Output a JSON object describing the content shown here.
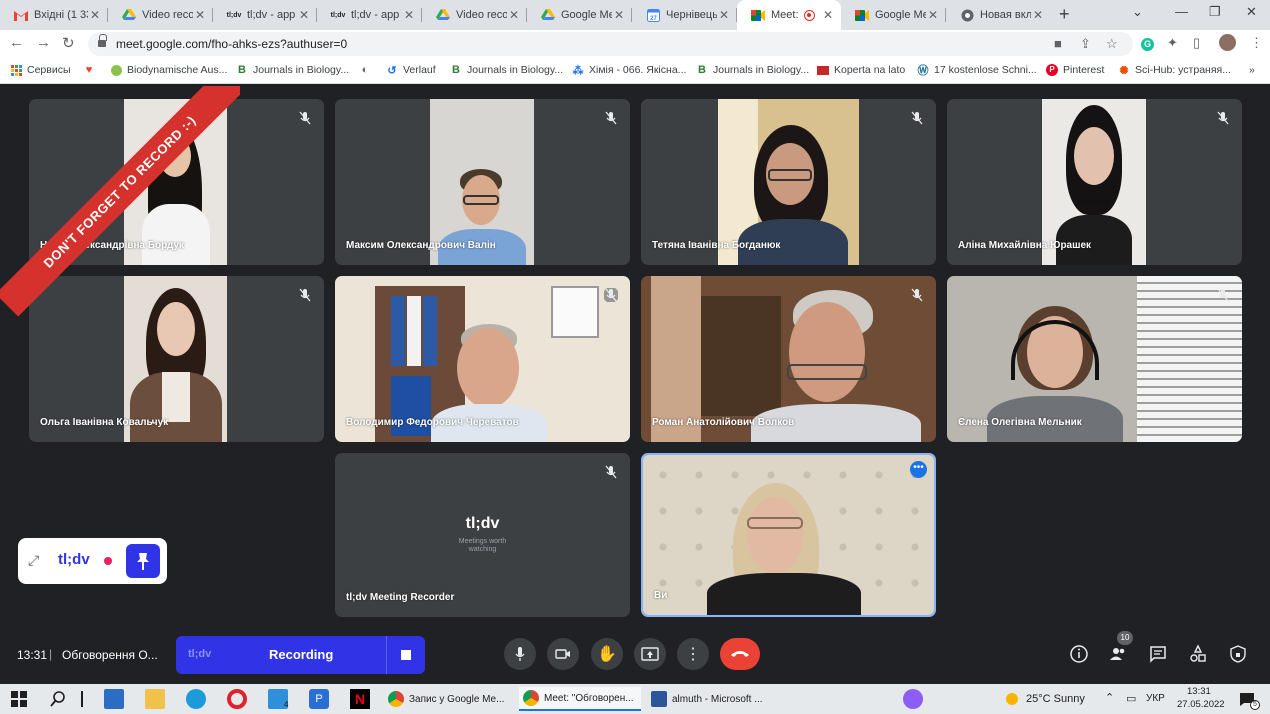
{
  "browser": {
    "tabs": [
      {
        "title": "Вхідні (1 33",
        "icon": "gmail-icon"
      },
      {
        "title": "Video recor",
        "icon": "drive-icon"
      },
      {
        "title": "tl;dv - app",
        "icon": "tldv-icon"
      },
      {
        "title": "tl;dv - app",
        "icon": "tldv-icon"
      },
      {
        "title": "Video recor",
        "icon": "drive-icon"
      },
      {
        "title": "Google Me",
        "icon": "drive-icon"
      },
      {
        "title": "Чернівецьк",
        "icon": "calendar-icon"
      },
      {
        "title": "Meet: ",
        "icon": "meet-icon"
      },
      {
        "title": "Google Me",
        "icon": "meet-icon"
      },
      {
        "title": "Новая вкл",
        "icon": "chrome-icon"
      }
    ],
    "active_tab": 7,
    "url": "meet.google.com/fho-ahks-ezs?authuser=0",
    "bookmarks": [
      "Сервисы",
      "",
      "Biodynamische Aus...",
      "Journals in Biology...",
      "",
      "Verlauf",
      "Journals in Biology...",
      "Хімія - 066. Якісна...",
      "Journals in Biology...",
      "Koperta na lato",
      "17 kostenlose Schni...",
      "Pinterest",
      "Sci-Hub: устраняя..."
    ],
    "bookmarks_overflow": "»"
  },
  "meet": {
    "participants": [
      {
        "name": "Надія Олександрівна Бордук",
        "muted": true
      },
      {
        "name": "Максим Олександрович Валін",
        "muted": true
      },
      {
        "name": "Тетяна Іванівна Богданюк",
        "muted": true
      },
      {
        "name": "Аліна Михайлівна Юрашек",
        "muted": true
      },
      {
        "name": "Ольга Іванівна Ковальчук",
        "muted": true
      },
      {
        "name": "Володимир Федорович Череватов",
        "muted": true
      },
      {
        "name": "Роман Анатолійович Волков",
        "muted": true
      },
      {
        "name": "Єлена Олегівна Мельник",
        "muted": true
      },
      {
        "name": "tl;dv Meeting Recorder",
        "muted": true
      },
      {
        "name": "Ви",
        "muted": false
      }
    ],
    "banner": "DON'T FORGET TO RECORD :-)",
    "recorder_tile": {
      "logo": "tl;dv",
      "tagline_1": "Meetings worth",
      "tagline_2": "watching"
    },
    "widget": {
      "logo": "tl;dv"
    },
    "bottom": {
      "time": "13:31",
      "separator": "|",
      "meeting_name": "Обговорення О...",
      "rec_logo": "tl;dv",
      "rec_label": "Recording",
      "people_count": "10"
    }
  },
  "taskbar": {
    "apps": [
      {
        "label": "Запис у Google Me...",
        "color": "#db4437"
      },
      {
        "label": "Meet: \"Обговорен...",
        "color": "#db4437"
      },
      {
        "label": "almuth - Microsoft ...",
        "color": "#2b579a"
      }
    ],
    "mail_badge": "4",
    "weather": "25°C  Sunny",
    "lang": "УКР",
    "clock_time": "13:31",
    "clock_date": "27.05.2022",
    "notif_badge": "5"
  },
  "colors": {
    "meet_bg": "#202124",
    "tile_bg": "#3c4043",
    "tldv_blue": "#3034e6",
    "end_call": "#ea4335",
    "active_outline": "#8ab4f8"
  }
}
